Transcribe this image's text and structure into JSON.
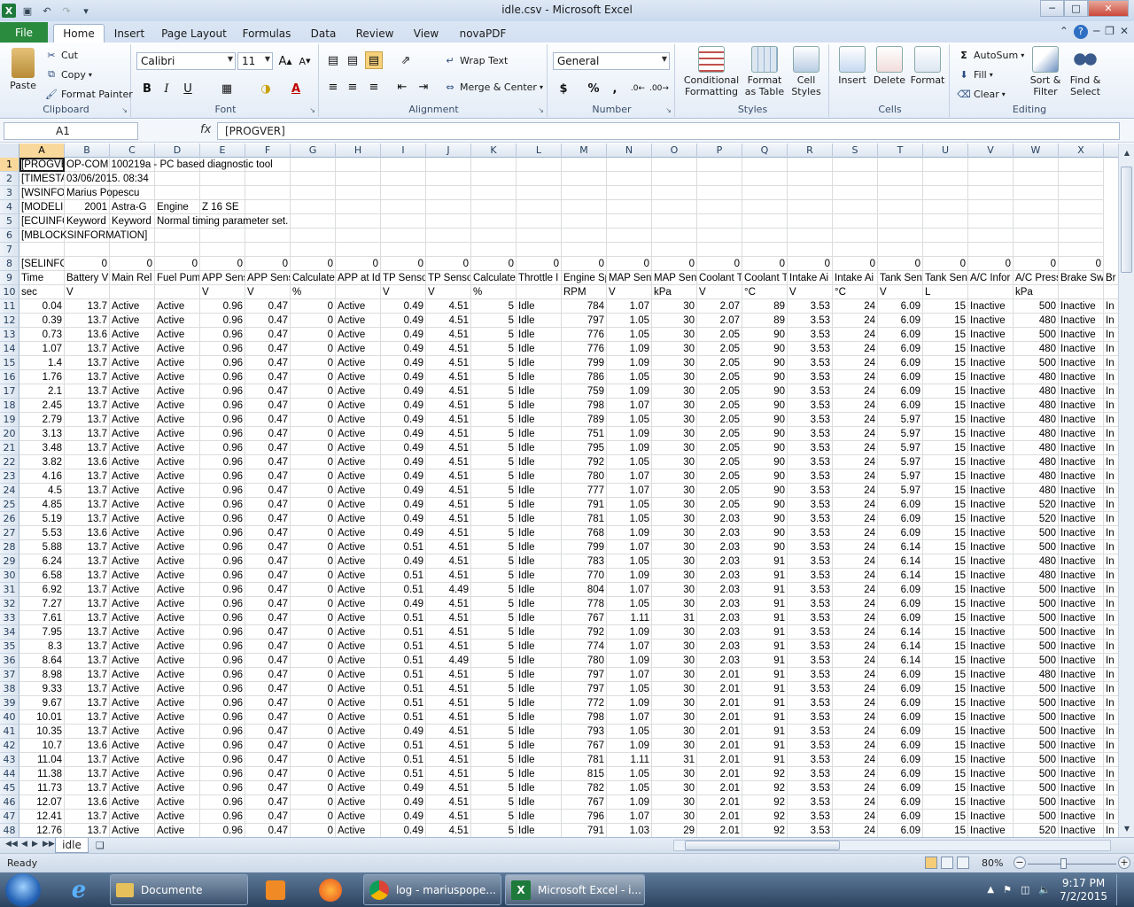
{
  "window": {
    "title": "idle.csv - Microsoft Excel"
  },
  "ribbon_tabs": [
    {
      "label": "File"
    },
    {
      "label": "Home"
    },
    {
      "label": "Insert"
    },
    {
      "label": "Page Layout"
    },
    {
      "label": "Formulas"
    },
    {
      "label": "Data"
    },
    {
      "label": "Review"
    },
    {
      "label": "View"
    },
    {
      "label": "novaPDF"
    }
  ],
  "clipboard": {
    "paste": "Paste",
    "cut": "Cut",
    "copy": "Copy",
    "format_painter": "Format Painter",
    "label": "Clipboard"
  },
  "font": {
    "name": "Calibri",
    "size": "11",
    "bold": "B",
    "italic": "I",
    "underline": "U",
    "label": "Font"
  },
  "alignment": {
    "wrap_text": "Wrap Text",
    "merge_center": "Merge & Center",
    "label": "Alignment"
  },
  "number": {
    "format": "General",
    "currency": "$",
    "percent": "%",
    "comma": ",",
    "label": "Number"
  },
  "styles": {
    "conditional": "Conditional",
    "conditional2": "Formatting",
    "format_table": "Format",
    "format_table2": "as Table",
    "cell_styles": "Cell",
    "cell_styles2": "Styles",
    "label": "Styles"
  },
  "cells": {
    "insert": "Insert",
    "delete": "Delete",
    "format": "Format",
    "label": "Cells"
  },
  "editing": {
    "autosum": "AutoSum",
    "fill": "Fill",
    "clear": "Clear",
    "sort": "Sort &",
    "sort2": "Filter",
    "find": "Find &",
    "find2": "Select",
    "label": "Editing"
  },
  "formula_bar": {
    "name_box": "A1",
    "fx": "fx",
    "content": "[PROGVER]"
  },
  "columns": [
    "A",
    "B",
    "C",
    "D",
    "E",
    "F",
    "G",
    "H",
    "I",
    "J",
    "K",
    "L",
    "M",
    "N",
    "O",
    "P",
    "Q",
    "R",
    "S",
    "T",
    "U",
    "V",
    "W",
    "X"
  ],
  "header_rows": [
    {
      "row": "1",
      "cells": [
        "[PROGVE",
        "OP-COM 100219a - PC based diagnostic tool"
      ]
    },
    {
      "row": "2",
      "cells": [
        "[TIMESTA",
        "03/06/2015. 08:34"
      ]
    },
    {
      "row": "3",
      "cells": [
        "[WSINFO",
        "Marius Popescu"
      ]
    },
    {
      "row": "4",
      "cells": [
        "[MODELI",
        "2001",
        "Astra-G",
        "Engine",
        "Z 16 SE"
      ]
    },
    {
      "row": "5",
      "cells": [
        "[ECUINFC",
        "Keyword",
        "Keyword",
        "Normal timing parameter set."
      ]
    },
    {
      "row": "6",
      "cells": [
        "[MBLOCKSINFORMATION]"
      ]
    },
    {
      "row": "7",
      "cells": []
    },
    {
      "row": "8",
      "cells": [
        "[SELINFO",
        "0",
        "0",
        "0",
        "0",
        "0",
        "0",
        "0",
        "0",
        "0",
        "0",
        "0",
        "0",
        "0",
        "0",
        "0",
        "0",
        "0",
        "0",
        "0",
        "0",
        "0",
        "0",
        "0"
      ]
    },
    {
      "row": "9",
      "cells": [
        "Time",
        "Battery V",
        "Main Rel",
        "Fuel Pum",
        "APP Sens",
        "APP Sens",
        "Calculate",
        "APP at Id",
        "TP Senso",
        "TP Senso",
        "Calculate",
        "Throttle I",
        "Engine Sp",
        "MAP Sen:",
        "MAP Sen:",
        "Coolant T",
        "Coolant T",
        "Intake Ai",
        "Intake Ai",
        "Tank Sen",
        "Tank Sen",
        "A/C Infor",
        "A/C Press",
        "Brake Sw",
        "Br"
      ]
    },
    {
      "row": "10",
      "cells": [
        "sec",
        "V",
        "",
        "",
        "V",
        "V",
        "%",
        "",
        "V",
        "V",
        "%",
        "",
        "RPM",
        "V",
        "kPa",
        "V",
        "°C",
        "V",
        "°C",
        "V",
        "L",
        "",
        "kPa",
        "",
        ""
      ]
    }
  ],
  "data_rows": [
    [
      "11",
      "0.04",
      "13.7",
      "Active",
      "Active",
      "0.96",
      "0.47",
      "0",
      "Active",
      "0.49",
      "4.51",
      "5",
      "Idle",
      "784",
      "1.07",
      "30",
      "2.07",
      "89",
      "3.53",
      "24",
      "6.09",
      "15",
      "Inactive",
      "500",
      "Inactive",
      "In"
    ],
    [
      "12",
      "0.39",
      "13.7",
      "Active",
      "Active",
      "0.96",
      "0.47",
      "0",
      "Active",
      "0.49",
      "4.51",
      "5",
      "Idle",
      "797",
      "1.05",
      "30",
      "2.07",
      "89",
      "3.53",
      "24",
      "6.09",
      "15",
      "Inactive",
      "480",
      "Inactive",
      "In"
    ],
    [
      "13",
      "0.73",
      "13.6",
      "Active",
      "Active",
      "0.96",
      "0.47",
      "0",
      "Active",
      "0.49",
      "4.51",
      "5",
      "Idle",
      "776",
      "1.05",
      "30",
      "2.05",
      "90",
      "3.53",
      "24",
      "6.09",
      "15",
      "Inactive",
      "500",
      "Inactive",
      "In"
    ],
    [
      "14",
      "1.07",
      "13.7",
      "Active",
      "Active",
      "0.96",
      "0.47",
      "0",
      "Active",
      "0.49",
      "4.51",
      "5",
      "Idle",
      "776",
      "1.09",
      "30",
      "2.05",
      "90",
      "3.53",
      "24",
      "6.09",
      "15",
      "Inactive",
      "480",
      "Inactive",
      "In"
    ],
    [
      "15",
      "1.4",
      "13.7",
      "Active",
      "Active",
      "0.96",
      "0.47",
      "0",
      "Active",
      "0.49",
      "4.51",
      "5",
      "Idle",
      "799",
      "1.09",
      "30",
      "2.05",
      "90",
      "3.53",
      "24",
      "6.09",
      "15",
      "Inactive",
      "500",
      "Inactive",
      "In"
    ],
    [
      "16",
      "1.76",
      "13.7",
      "Active",
      "Active",
      "0.96",
      "0.47",
      "0",
      "Active",
      "0.49",
      "4.51",
      "5",
      "Idle",
      "786",
      "1.05",
      "30",
      "2.05",
      "90",
      "3.53",
      "24",
      "6.09",
      "15",
      "Inactive",
      "480",
      "Inactive",
      "In"
    ],
    [
      "17",
      "2.1",
      "13.7",
      "Active",
      "Active",
      "0.96",
      "0.47",
      "0",
      "Active",
      "0.49",
      "4.51",
      "5",
      "Idle",
      "759",
      "1.09",
      "30",
      "2.05",
      "90",
      "3.53",
      "24",
      "6.09",
      "15",
      "Inactive",
      "480",
      "Inactive",
      "In"
    ],
    [
      "18",
      "2.45",
      "13.7",
      "Active",
      "Active",
      "0.96",
      "0.47",
      "0",
      "Active",
      "0.49",
      "4.51",
      "5",
      "Idle",
      "798",
      "1.07",
      "30",
      "2.05",
      "90",
      "3.53",
      "24",
      "6.09",
      "15",
      "Inactive",
      "480",
      "Inactive",
      "In"
    ],
    [
      "19",
      "2.79",
      "13.7",
      "Active",
      "Active",
      "0.96",
      "0.47",
      "0",
      "Active",
      "0.49",
      "4.51",
      "5",
      "Idle",
      "789",
      "1.05",
      "30",
      "2.05",
      "90",
      "3.53",
      "24",
      "5.97",
      "15",
      "Inactive",
      "480",
      "Inactive",
      "In"
    ],
    [
      "20",
      "3.13",
      "13.7",
      "Active",
      "Active",
      "0.96",
      "0.47",
      "0",
      "Active",
      "0.49",
      "4.51",
      "5",
      "Idle",
      "751",
      "1.09",
      "30",
      "2.05",
      "90",
      "3.53",
      "24",
      "5.97",
      "15",
      "Inactive",
      "480",
      "Inactive",
      "In"
    ],
    [
      "21",
      "3.48",
      "13.7",
      "Active",
      "Active",
      "0.96",
      "0.47",
      "0",
      "Active",
      "0.49",
      "4.51",
      "5",
      "Idle",
      "795",
      "1.09",
      "30",
      "2.05",
      "90",
      "3.53",
      "24",
      "5.97",
      "15",
      "Inactive",
      "480",
      "Inactive",
      "In"
    ],
    [
      "22",
      "3.82",
      "13.6",
      "Active",
      "Active",
      "0.96",
      "0.47",
      "0",
      "Active",
      "0.49",
      "4.51",
      "5",
      "Idle",
      "792",
      "1.05",
      "30",
      "2.05",
      "90",
      "3.53",
      "24",
      "5.97",
      "15",
      "Inactive",
      "480",
      "Inactive",
      "In"
    ],
    [
      "23",
      "4.16",
      "13.7",
      "Active",
      "Active",
      "0.96",
      "0.47",
      "0",
      "Active",
      "0.49",
      "4.51",
      "5",
      "Idle",
      "780",
      "1.07",
      "30",
      "2.05",
      "90",
      "3.53",
      "24",
      "5.97",
      "15",
      "Inactive",
      "480",
      "Inactive",
      "In"
    ],
    [
      "24",
      "4.5",
      "13.7",
      "Active",
      "Active",
      "0.96",
      "0.47",
      "0",
      "Active",
      "0.49",
      "4.51",
      "5",
      "Idle",
      "777",
      "1.07",
      "30",
      "2.05",
      "90",
      "3.53",
      "24",
      "5.97",
      "15",
      "Inactive",
      "480",
      "Inactive",
      "In"
    ],
    [
      "25",
      "4.85",
      "13.7",
      "Active",
      "Active",
      "0.96",
      "0.47",
      "0",
      "Active",
      "0.49",
      "4.51",
      "5",
      "Idle",
      "791",
      "1.05",
      "30",
      "2.05",
      "90",
      "3.53",
      "24",
      "6.09",
      "15",
      "Inactive",
      "520",
      "Inactive",
      "In"
    ],
    [
      "26",
      "5.19",
      "13.7",
      "Active",
      "Active",
      "0.96",
      "0.47",
      "0",
      "Active",
      "0.49",
      "4.51",
      "5",
      "Idle",
      "781",
      "1.05",
      "30",
      "2.03",
      "90",
      "3.53",
      "24",
      "6.09",
      "15",
      "Inactive",
      "520",
      "Inactive",
      "In"
    ],
    [
      "27",
      "5.53",
      "13.6",
      "Active",
      "Active",
      "0.96",
      "0.47",
      "0",
      "Active",
      "0.49",
      "4.51",
      "5",
      "Idle",
      "768",
      "1.09",
      "30",
      "2.03",
      "90",
      "3.53",
      "24",
      "6.09",
      "15",
      "Inactive",
      "500",
      "Inactive",
      "In"
    ],
    [
      "28",
      "5.88",
      "13.7",
      "Active",
      "Active",
      "0.96",
      "0.47",
      "0",
      "Active",
      "0.51",
      "4.51",
      "5",
      "Idle",
      "799",
      "1.07",
      "30",
      "2.03",
      "90",
      "3.53",
      "24",
      "6.14",
      "15",
      "Inactive",
      "500",
      "Inactive",
      "In"
    ],
    [
      "29",
      "6.24",
      "13.7",
      "Active",
      "Active",
      "0.96",
      "0.47",
      "0",
      "Active",
      "0.49",
      "4.51",
      "5",
      "Idle",
      "783",
      "1.05",
      "30",
      "2.03",
      "91",
      "3.53",
      "24",
      "6.14",
      "15",
      "Inactive",
      "480",
      "Inactive",
      "In"
    ],
    [
      "30",
      "6.58",
      "13.7",
      "Active",
      "Active",
      "0.96",
      "0.47",
      "0",
      "Active",
      "0.51",
      "4.51",
      "5",
      "Idle",
      "770",
      "1.09",
      "30",
      "2.03",
      "91",
      "3.53",
      "24",
      "6.14",
      "15",
      "Inactive",
      "480",
      "Inactive",
      "In"
    ],
    [
      "31",
      "6.92",
      "13.7",
      "Active",
      "Active",
      "0.96",
      "0.47",
      "0",
      "Active",
      "0.51",
      "4.49",
      "5",
      "Idle",
      "804",
      "1.07",
      "30",
      "2.03",
      "91",
      "3.53",
      "24",
      "6.09",
      "15",
      "Inactive",
      "500",
      "Inactive",
      "In"
    ],
    [
      "32",
      "7.27",
      "13.7",
      "Active",
      "Active",
      "0.96",
      "0.47",
      "0",
      "Active",
      "0.49",
      "4.51",
      "5",
      "Idle",
      "778",
      "1.05",
      "30",
      "2.03",
      "91",
      "3.53",
      "24",
      "6.09",
      "15",
      "Inactive",
      "500",
      "Inactive",
      "In"
    ],
    [
      "33",
      "7.61",
      "13.7",
      "Active",
      "Active",
      "0.96",
      "0.47",
      "0",
      "Active",
      "0.51",
      "4.51",
      "5",
      "Idle",
      "767",
      "1.11",
      "31",
      "2.03",
      "91",
      "3.53",
      "24",
      "6.09",
      "15",
      "Inactive",
      "500",
      "Inactive",
      "In"
    ],
    [
      "34",
      "7.95",
      "13.7",
      "Active",
      "Active",
      "0.96",
      "0.47",
      "0",
      "Active",
      "0.51",
      "4.51",
      "5",
      "Idle",
      "792",
      "1.09",
      "30",
      "2.03",
      "91",
      "3.53",
      "24",
      "6.14",
      "15",
      "Inactive",
      "500",
      "Inactive",
      "In"
    ],
    [
      "35",
      "8.3",
      "13.7",
      "Active",
      "Active",
      "0.96",
      "0.47",
      "0",
      "Active",
      "0.51",
      "4.51",
      "5",
      "Idle",
      "774",
      "1.07",
      "30",
      "2.03",
      "91",
      "3.53",
      "24",
      "6.14",
      "15",
      "Inactive",
      "500",
      "Inactive",
      "In"
    ],
    [
      "36",
      "8.64",
      "13.7",
      "Active",
      "Active",
      "0.96",
      "0.47",
      "0",
      "Active",
      "0.51",
      "4.49",
      "5",
      "Idle",
      "780",
      "1.09",
      "30",
      "2.03",
      "91",
      "3.53",
      "24",
      "6.14",
      "15",
      "Inactive",
      "500",
      "Inactive",
      "In"
    ],
    [
      "37",
      "8.98",
      "13.7",
      "Active",
      "Active",
      "0.96",
      "0.47",
      "0",
      "Active",
      "0.51",
      "4.51",
      "5",
      "Idle",
      "797",
      "1.07",
      "30",
      "2.01",
      "91",
      "3.53",
      "24",
      "6.09",
      "15",
      "Inactive",
      "480",
      "Inactive",
      "In"
    ],
    [
      "38",
      "9.33",
      "13.7",
      "Active",
      "Active",
      "0.96",
      "0.47",
      "0",
      "Active",
      "0.51",
      "4.51",
      "5",
      "Idle",
      "797",
      "1.05",
      "30",
      "2.01",
      "91",
      "3.53",
      "24",
      "6.09",
      "15",
      "Inactive",
      "500",
      "Inactive",
      "In"
    ],
    [
      "39",
      "9.67",
      "13.7",
      "Active",
      "Active",
      "0.96",
      "0.47",
      "0",
      "Active",
      "0.51",
      "4.51",
      "5",
      "Idle",
      "772",
      "1.09",
      "30",
      "2.01",
      "91",
      "3.53",
      "24",
      "6.09",
      "15",
      "Inactive",
      "500",
      "Inactive",
      "In"
    ],
    [
      "40",
      "10.01",
      "13.7",
      "Active",
      "Active",
      "0.96",
      "0.47",
      "0",
      "Active",
      "0.51",
      "4.51",
      "5",
      "Idle",
      "798",
      "1.07",
      "30",
      "2.01",
      "91",
      "3.53",
      "24",
      "6.09",
      "15",
      "Inactive",
      "500",
      "Inactive",
      "In"
    ],
    [
      "41",
      "10.35",
      "13.7",
      "Active",
      "Active",
      "0.96",
      "0.47",
      "0",
      "Active",
      "0.49",
      "4.51",
      "5",
      "Idle",
      "793",
      "1.05",
      "30",
      "2.01",
      "91",
      "3.53",
      "24",
      "6.09",
      "15",
      "Inactive",
      "500",
      "Inactive",
      "In"
    ],
    [
      "42",
      "10.7",
      "13.6",
      "Active",
      "Active",
      "0.96",
      "0.47",
      "0",
      "Active",
      "0.51",
      "4.51",
      "5",
      "Idle",
      "767",
      "1.09",
      "30",
      "2.01",
      "91",
      "3.53",
      "24",
      "6.09",
      "15",
      "Inactive",
      "500",
      "Inactive",
      "In"
    ],
    [
      "43",
      "11.04",
      "13.7",
      "Active",
      "Active",
      "0.96",
      "0.47",
      "0",
      "Active",
      "0.51",
      "4.51",
      "5",
      "Idle",
      "781",
      "1.11",
      "31",
      "2.01",
      "91",
      "3.53",
      "24",
      "6.09",
      "15",
      "Inactive",
      "500",
      "Inactive",
      "In"
    ],
    [
      "44",
      "11.38",
      "13.7",
      "Active",
      "Active",
      "0.96",
      "0.47",
      "0",
      "Active",
      "0.51",
      "4.51",
      "5",
      "Idle",
      "815",
      "1.05",
      "30",
      "2.01",
      "92",
      "3.53",
      "24",
      "6.09",
      "15",
      "Inactive",
      "500",
      "Inactive",
      "In"
    ],
    [
      "45",
      "11.73",
      "13.7",
      "Active",
      "Active",
      "0.96",
      "0.47",
      "0",
      "Active",
      "0.49",
      "4.51",
      "5",
      "Idle",
      "782",
      "1.05",
      "30",
      "2.01",
      "92",
      "3.53",
      "24",
      "6.09",
      "15",
      "Inactive",
      "500",
      "Inactive",
      "In"
    ],
    [
      "46",
      "12.07",
      "13.6",
      "Active",
      "Active",
      "0.96",
      "0.47",
      "0",
      "Active",
      "0.49",
      "4.51",
      "5",
      "Idle",
      "767",
      "1.09",
      "30",
      "2.01",
      "92",
      "3.53",
      "24",
      "6.09",
      "15",
      "Inactive",
      "500",
      "Inactive",
      "In"
    ],
    [
      "47",
      "12.41",
      "13.7",
      "Active",
      "Active",
      "0.96",
      "0.47",
      "0",
      "Active",
      "0.49",
      "4.51",
      "5",
      "Idle",
      "796",
      "1.07",
      "30",
      "2.01",
      "92",
      "3.53",
      "24",
      "6.09",
      "15",
      "Inactive",
      "500",
      "Inactive",
      "In"
    ],
    [
      "48",
      "12.76",
      "13.7",
      "Active",
      "Active",
      "0.96",
      "0.47",
      "0",
      "Active",
      "0.49",
      "4.51",
      "5",
      "Idle",
      "791",
      "1.03",
      "29",
      "2.01",
      "92",
      "3.53",
      "24",
      "6.09",
      "15",
      "Inactive",
      "520",
      "Inactive",
      "In"
    ]
  ],
  "sheet_tabs": [
    {
      "label": "idle"
    }
  ],
  "status": {
    "ready": "Ready",
    "zoom": "80%"
  },
  "taskbar": {
    "windows": [
      {
        "label": "Documente"
      },
      {
        "label": "log - mariuspope..."
      },
      {
        "label": "Microsoft Excel - i..."
      }
    ],
    "time": "9:17 PM",
    "date": "7/2/2015"
  },
  "colors": {
    "excel_green": "#2a8a3e",
    "selection": "#f9d99b",
    "ribbon_bg": "#e4ecf7"
  }
}
